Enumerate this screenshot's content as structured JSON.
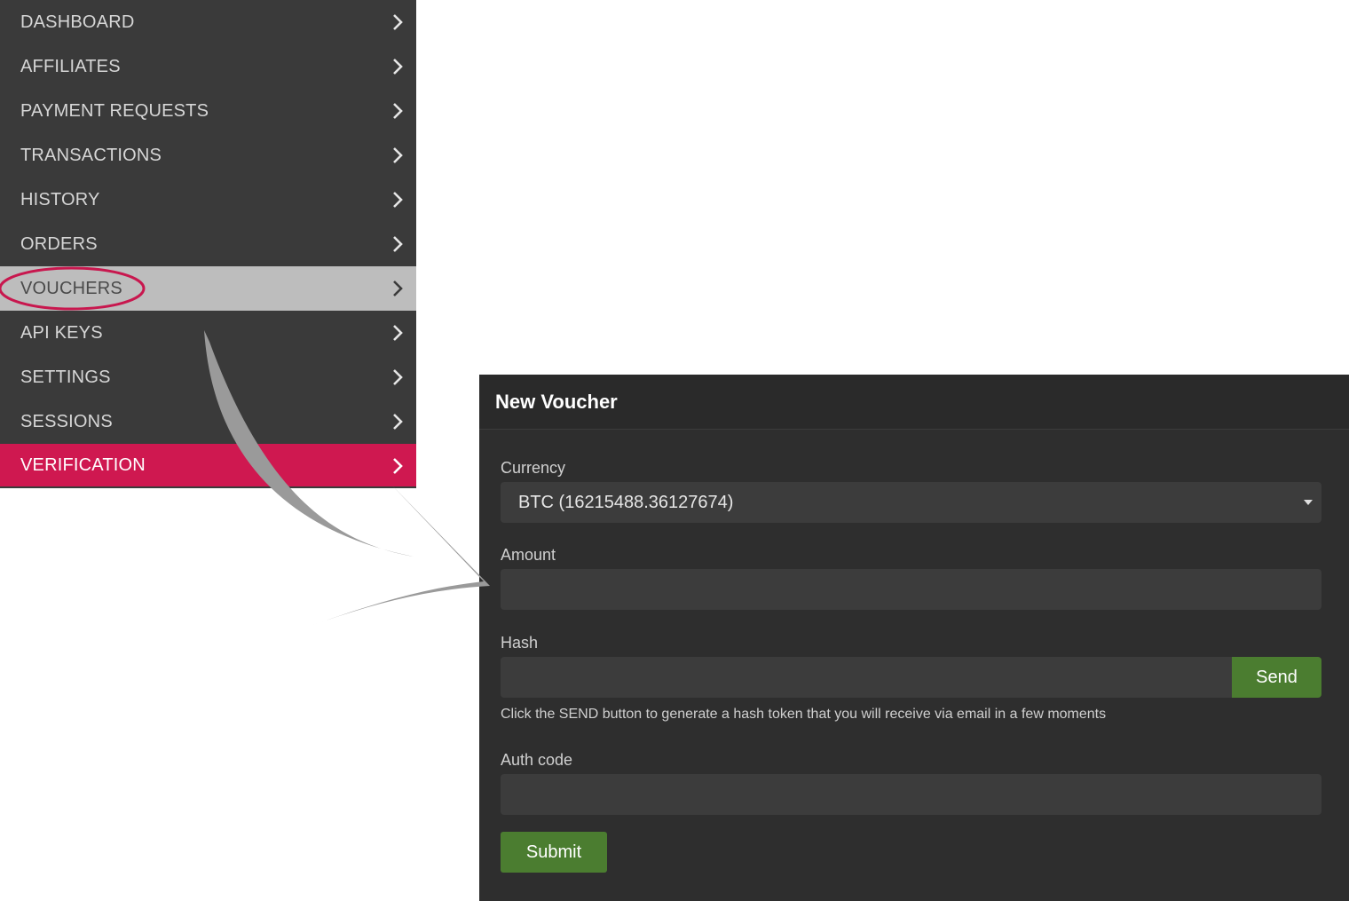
{
  "menu": {
    "items": [
      {
        "label": "DASHBOARD",
        "state": "normal"
      },
      {
        "label": "AFFILIATES",
        "state": "normal"
      },
      {
        "label": "PAYMENT REQUESTS",
        "state": "normal"
      },
      {
        "label": "TRANSACTIONS",
        "state": "normal"
      },
      {
        "label": "HISTORY",
        "state": "normal"
      },
      {
        "label": "ORDERS",
        "state": "normal"
      },
      {
        "label": "VOUCHERS",
        "state": "active"
      },
      {
        "label": "API KEYS",
        "state": "normal"
      },
      {
        "label": "SETTINGS",
        "state": "normal"
      },
      {
        "label": "SESSIONS",
        "state": "normal"
      },
      {
        "label": "VERIFICATION",
        "state": "highlight"
      }
    ]
  },
  "voucher_form": {
    "title": "New Voucher",
    "currency_label": "Currency",
    "currency_value": "BTC (16215488.36127674)",
    "amount_label": "Amount",
    "amount_value": "",
    "hash_label": "Hash",
    "hash_value": "",
    "send_label": "Send",
    "hash_help": "Click the SEND button to generate a hash token that you will receive via email in a few moments",
    "auth_label": "Auth code",
    "auth_value": "",
    "submit_label": "Submit"
  },
  "colors": {
    "menu_bg": "#3a3a3a",
    "active_bg": "#bdbdbd",
    "highlight_bg": "#cf1850",
    "annotation": "#c8174e",
    "button_green": "#4b7d30",
    "panel_bg": "#2e2e2e"
  }
}
